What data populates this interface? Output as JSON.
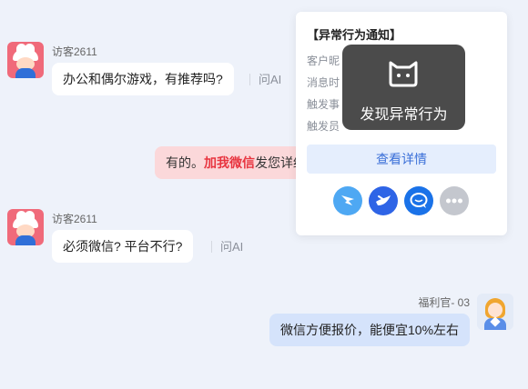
{
  "messages": [
    {
      "sender": "访客2611",
      "text": "办公和偶尔游戏，有推荐吗?",
      "ask_ai": "问AI"
    },
    {
      "text_prefix": "有的。",
      "text_highlight": "加我微信",
      "text_suffix": "发您详细"
    },
    {
      "sender": "访客2611",
      "text": "必须微信? 平台不行?",
      "ask_ai": "问AI"
    },
    {
      "sender": "福利官- 03",
      "text": "微信方便报价，能便宜10%左右"
    }
  ],
  "notification": {
    "title": "【异常行为通知】",
    "rows": [
      "客户昵",
      "消息时",
      "触发事",
      "触发员"
    ],
    "detail_button": "查看详情",
    "share_icons": [
      "dingtalk-icon",
      "feishu-icon",
      "chat-icon",
      "more-icon"
    ]
  },
  "toast": {
    "label": "发现异常行为",
    "icon": "cat-face-icon"
  },
  "colors": {
    "highlight": "#e8343f",
    "button_text": "#3a6fd8"
  }
}
